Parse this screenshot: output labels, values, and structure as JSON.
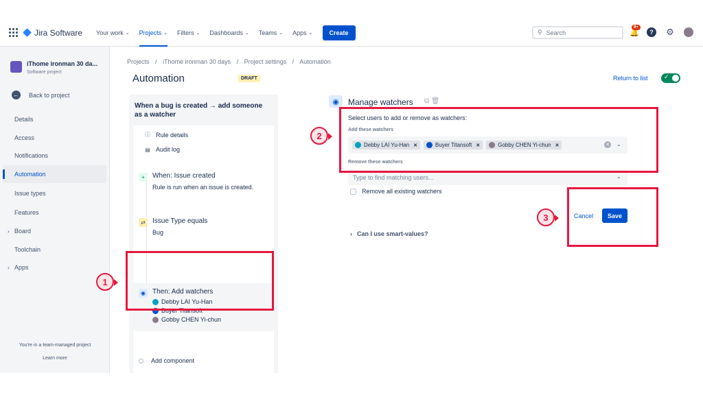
{
  "topnav": {
    "logo": "Jira Software",
    "items": [
      {
        "label": "Your work"
      },
      {
        "label": "Projects"
      },
      {
        "label": "Filters"
      },
      {
        "label": "Dashboards"
      },
      {
        "label": "Teams"
      },
      {
        "label": "Apps"
      }
    ],
    "create": "Create",
    "search_placeholder": "Search",
    "notif_badge": "9+",
    "help": "?"
  },
  "sidebar": {
    "project_name": "iThome ironman 30 da...",
    "project_type": "Software project",
    "back": "Back to project",
    "items": [
      {
        "label": "Details"
      },
      {
        "label": "Access"
      },
      {
        "label": "Notifications"
      },
      {
        "label": "Automation"
      },
      {
        "label": "Issue types"
      },
      {
        "label": "Features"
      },
      {
        "label": "Board"
      },
      {
        "label": "Toolchain"
      },
      {
        "label": "Apps"
      }
    ],
    "team_note": "You're in a team-managed project",
    "learn_more": "Learn more"
  },
  "main": {
    "breadcrumbs": [
      "Projects",
      "/",
      "iThome ironman 30 days",
      "/",
      "Project settings",
      "/",
      "Automation"
    ],
    "title": "Automation",
    "draft": "DRAFT",
    "return": "Return to list"
  },
  "rule": {
    "heading": "When a bug is created → add someone as a watcher",
    "details": "Rule details",
    "audit": "Audit log",
    "trigger_title": "When: Issue created",
    "trigger_sub": "Rule is run when an issue is created.",
    "condition_title": "Issue Type equals",
    "condition_sub": "Bug",
    "action_title": "Then: Add watchers",
    "watchers": [
      "Debby LAI Yu-Han",
      "Buyer Titansoft",
      "Gobby CHEN Yi-chun"
    ],
    "add_component": "Add component"
  },
  "editor": {
    "title": "Manage watchers",
    "select_label": "Select users to add or remove as watchers:",
    "add_label": "Add these watchers",
    "chips": [
      "Debby LAI Yu-Han",
      "Buyer Titansoft",
      "Gobby CHEN Yi-chun"
    ],
    "remove_label": "Remove these watchers",
    "find_placeholder": "Type to find matching users...",
    "remove_all": "Remove all existing watchers",
    "cancel": "Cancel",
    "save": "Save",
    "smart": "Can I use smart-values?"
  },
  "annotations": {
    "one": "1",
    "two": "2",
    "three": "3",
    "color": "#e5173f"
  },
  "colors": {
    "brand": "#0052cc",
    "toggle": "#00875a",
    "draft": "#fff0b3"
  }
}
